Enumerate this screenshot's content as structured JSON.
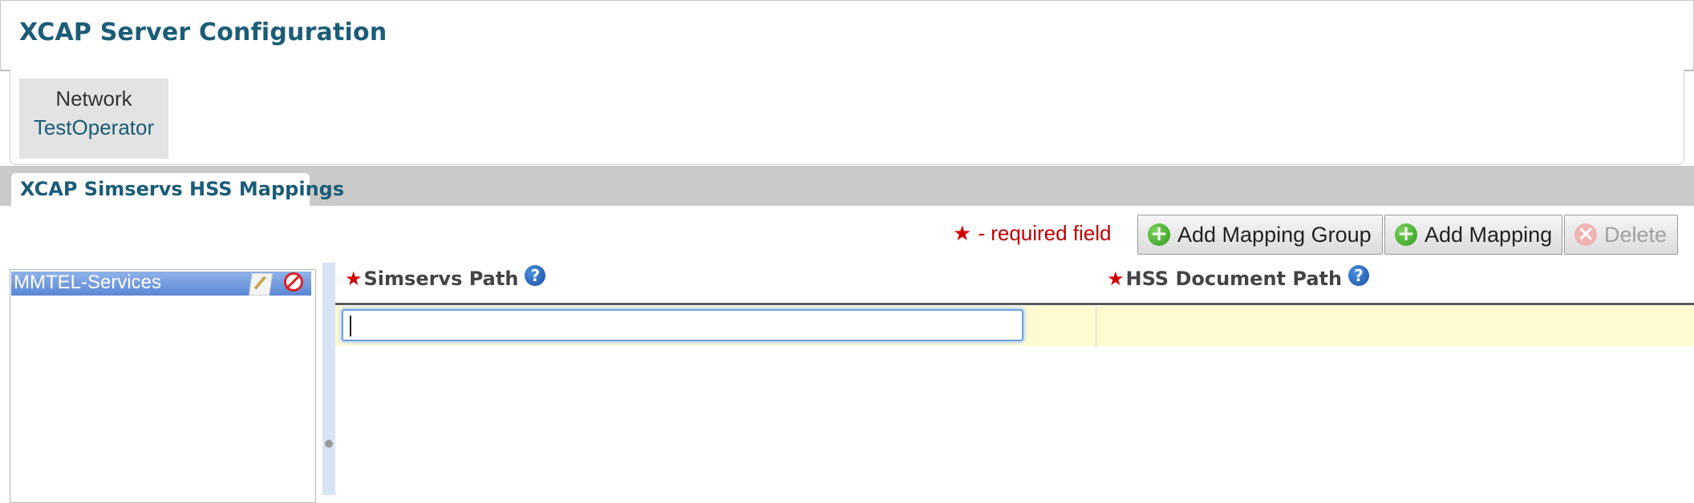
{
  "header": {
    "title": "XCAP Server Configuration"
  },
  "network": {
    "label": "Network",
    "value": "TestOperator"
  },
  "tabs": [
    {
      "label": "XCAP Simservs HSS Mappings",
      "active": true
    }
  ],
  "toolbar": {
    "required_note": "- required field",
    "add_mapping_group": "Add Mapping Group",
    "add_mapping": "Add Mapping",
    "delete": "Delete",
    "delete_disabled": true
  },
  "groups": [
    {
      "label": "MMTEL-Services",
      "selected": true
    }
  ],
  "grid": {
    "columns": [
      "Simservs Path",
      "HSS Document Path"
    ],
    "rows": [
      {
        "simservs_path": "",
        "hss_document_path": ""
      }
    ]
  },
  "colors": {
    "accent": "#1b5c77",
    "required": "#c00000",
    "selection": "#5a87d4",
    "row_highlight": "#fffbd0"
  },
  "icons": [
    "plus-circle-icon",
    "delete-circle-icon",
    "edit-icon",
    "no-entry-icon",
    "help-icon",
    "required-star-icon"
  ]
}
